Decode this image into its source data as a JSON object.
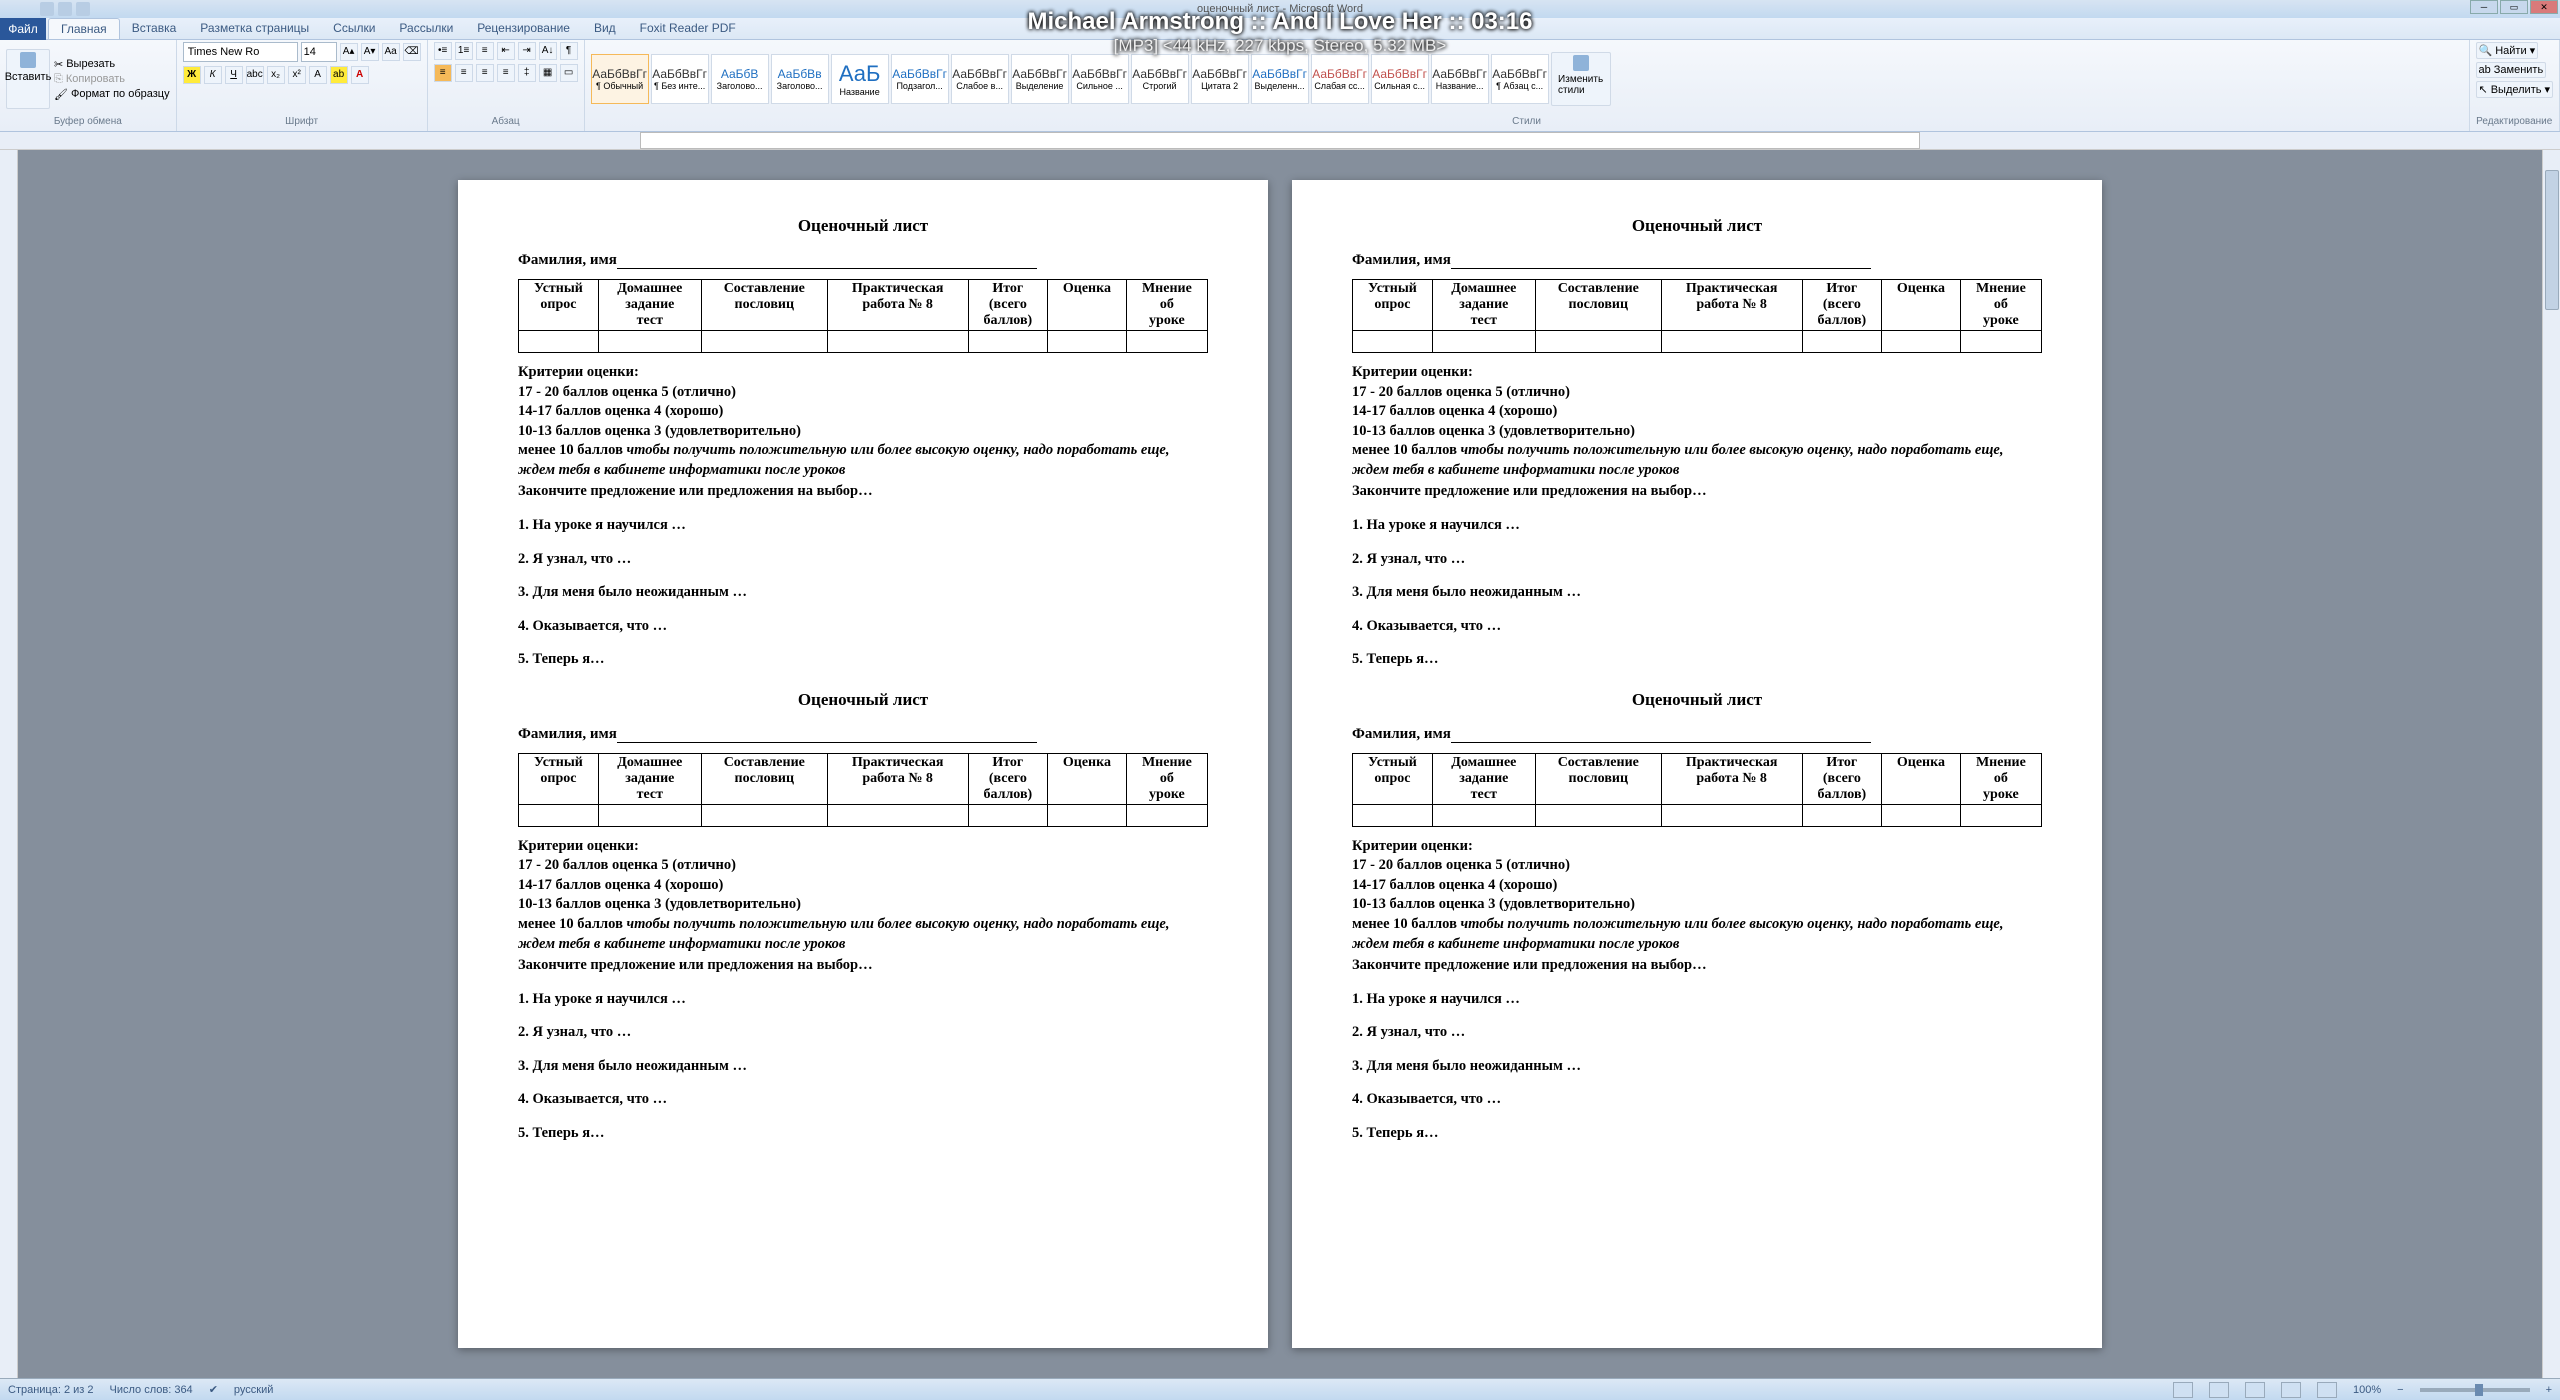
{
  "app": {
    "doc_title": "оценочный лист - Microsoft Word"
  },
  "media": {
    "title": "Michael Armstrong :: And I Love Her :: 03:16",
    "info": "[MP3] <44 kHz, 227 kbps, Stereo, 5.32 MB>"
  },
  "tabs": {
    "file": "Файл",
    "items": [
      "Главная",
      "Вставка",
      "Разметка страницы",
      "Ссылки",
      "Рассылки",
      "Рецензирование",
      "Вид",
      "Foxit Reader PDF"
    ]
  },
  "ribbon": {
    "clipboard": {
      "paste": "Вставить",
      "cut": "Вырезать",
      "copy": "Копировать",
      "format_painter": "Формат по образцу",
      "label": "Буфер обмена"
    },
    "font": {
      "name": "Times New Ro",
      "size": "14",
      "label": "Шрифт"
    },
    "paragraph": {
      "label": "Абзац"
    },
    "styles": {
      "label": "Стили",
      "items": [
        {
          "preview": "АаБбВвГг",
          "name": "¶ Обычный",
          "cls": "active"
        },
        {
          "preview": "АаБбВвГг",
          "name": "¶ Без инте..."
        },
        {
          "preview": "АаБбВ",
          "name": "Заголово...",
          "cls": "blue"
        },
        {
          "preview": "АаБбВв",
          "name": "Заголово...",
          "cls": "blue"
        },
        {
          "preview": "АаБ",
          "name": "Название",
          "cls": "big"
        },
        {
          "preview": "АаБбВвГг",
          "name": "Подзагол...",
          "cls": "blue"
        },
        {
          "preview": "АаБбВвГг",
          "name": "Слабое в..."
        },
        {
          "preview": "АаБбВвГг",
          "name": "Выделение"
        },
        {
          "preview": "АаБбВвГг",
          "name": "Сильное ..."
        },
        {
          "preview": "АаБбВвГг",
          "name": "Строгий"
        },
        {
          "preview": "АаБбВвГг",
          "name": "Цитата 2"
        },
        {
          "preview": "АаБбВвГг",
          "name": "Выделенн...",
          "cls": "blue"
        },
        {
          "preview": "АаБбВвГг",
          "name": "Слабая сс...",
          "cls": "red"
        },
        {
          "preview": "АаБбВвГг",
          "name": "Сильная с...",
          "cls": "red"
        },
        {
          "preview": "АаБбВвГг",
          "name": "Название..."
        },
        {
          "preview": "АаБбВвГг",
          "name": "¶ Абзац с..."
        }
      ],
      "change": "Изменить\nстили"
    },
    "editing": {
      "find": "Найти",
      "replace": "Заменить",
      "select": "Выделить",
      "label": "Редактирование"
    }
  },
  "sheet": {
    "title": "Оценочный лист",
    "name_label": "Фамилия, имя",
    "cols": [
      "Устный опрос",
      "Домашнее задание тест",
      "Составление пословиц",
      "Практическая работа № 8",
      "Итог (всего баллов)",
      "Оценка",
      "Мнение об уроке"
    ],
    "criteria_hdr": "Критерии оценки:",
    "c1": "17 - 20 баллов  оценка 5 (отлично)",
    "c2": "14-17 баллов  оценка 4 (хорошо)",
    "c3": "10-13 баллов  оценка 3 (удовлетворительно)",
    "c4a": "менее 10 баллов   ",
    "c4b": "чтобы получить положительную или более высокую  оценку, надо поработать еще, ждем тебя в кабинете информатики после уроков",
    "finish": "Закончите предложение или предложения на выбор…",
    "q1": "1. На уроке я научился …",
    "q2": "2. Я узнал, что …",
    "q3": "3. Для меня было неожиданным …",
    "q4": "4. Оказывается, что  …",
    "q5": "5. Теперь я…"
  },
  "status": {
    "page": "Страница: 2 из 2",
    "words": "Число слов: 364",
    "lang": "русский",
    "zoom": "100%"
  }
}
